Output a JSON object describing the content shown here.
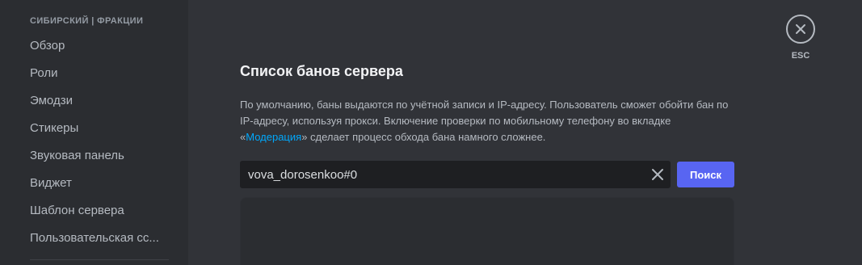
{
  "sidebar": {
    "header": "СИБИРСКИЙ | ФРАКЦИИ",
    "items": [
      {
        "label": "Обзор"
      },
      {
        "label": "Роли"
      },
      {
        "label": "Эмодзи"
      },
      {
        "label": "Стикеры"
      },
      {
        "label": "Звуковая панель"
      },
      {
        "label": "Виджет"
      },
      {
        "label": "Шаблон сервера"
      },
      {
        "label": "Пользовательская сс..."
      }
    ]
  },
  "main": {
    "title": "Список банов сервера",
    "description": {
      "text_before": "По умолчанию, баны выдаются по учётной записи и IP-адресу. Пользователь сможет обойти бан по IP-адресу, используя прокси. Включение проверки по мобильному телефону во вкладке «",
      "link": "Модерация",
      "text_after": "» сделает процесс обхода бана намного сложнее."
    },
    "search": {
      "value": "vova_dorosenkoo#0",
      "button_label": "Поиск"
    }
  },
  "close": {
    "label": "ESC"
  },
  "colors": {
    "accent": "#5865f2",
    "link": "#00a8fc",
    "sidebar_bg": "#2b2d31",
    "main_bg": "#313338",
    "input_bg": "#1e1f22"
  },
  "icons": {
    "clear": "close-icon",
    "esc": "close-circle-icon"
  }
}
